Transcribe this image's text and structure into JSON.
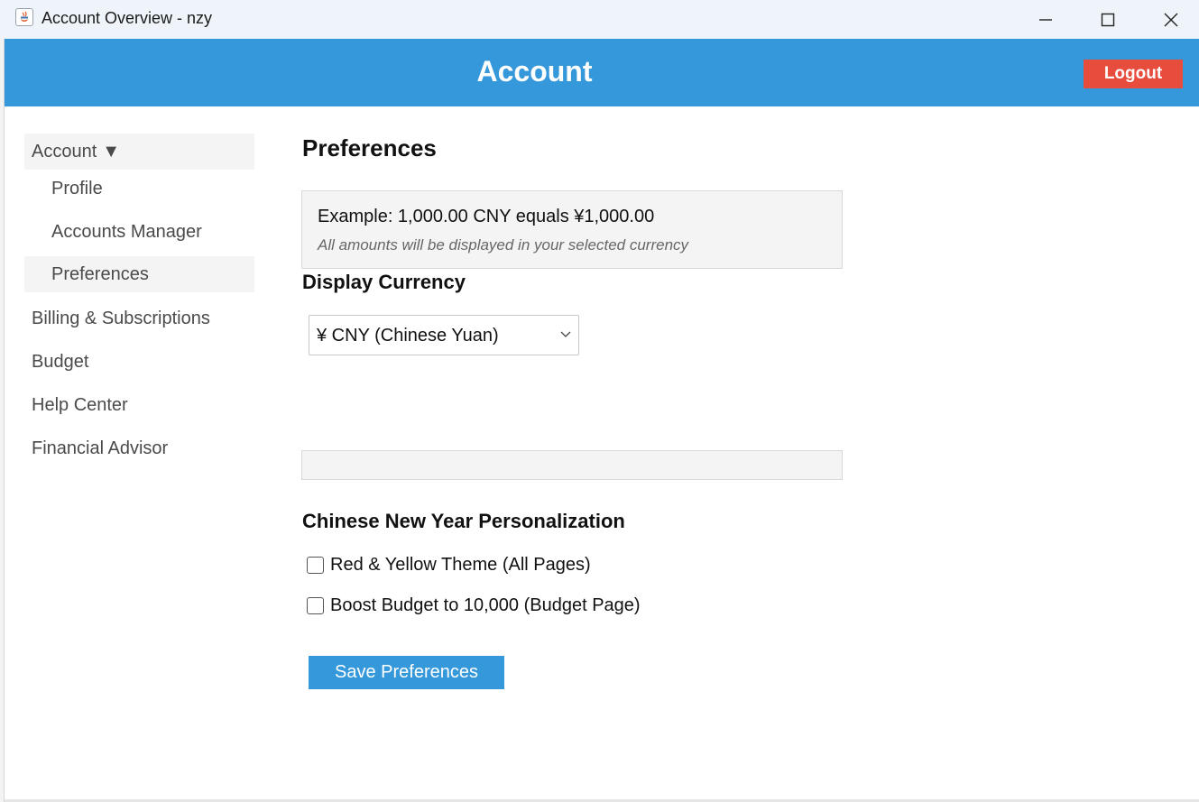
{
  "window": {
    "title": "Account Overview - nzy",
    "controls": [
      "minimize-icon",
      "maximize-icon",
      "close-icon"
    ]
  },
  "header": {
    "title": "Account",
    "logout_label": "Logout"
  },
  "sidebar": {
    "items": [
      {
        "label": "Account",
        "caret": "▼"
      },
      {
        "label": "Profile"
      },
      {
        "label": "Accounts Manager"
      },
      {
        "label": "Preferences"
      },
      {
        "label": "Billing & Subscriptions"
      },
      {
        "label": "Budget"
      },
      {
        "label": "Help Center"
      },
      {
        "label": "Financial Advisor"
      }
    ],
    "active": "Preferences"
  },
  "main": {
    "title": "Preferences",
    "example": {
      "line": "Example: 1,000.00 CNY equals ¥1,000.00",
      "note": "All amounts will be displayed in your selected currency"
    },
    "currency": {
      "heading": "Display Currency",
      "selected": "¥ CNY (Chinese Yuan)"
    },
    "personalization": {
      "heading": "Chinese New Year Personalization",
      "options": [
        {
          "label": "Red & Yellow Theme (All Pages)",
          "checked": false
        },
        {
          "label": "Boost Budget to 10,000 (Budget Page)",
          "checked": false
        }
      ]
    },
    "save_label": "Save Preferences"
  },
  "colors": {
    "header_bg": "#3598db",
    "logout_bg": "#e74c3c",
    "save_bg": "#3598db",
    "panel_bg": "#f4f4f4"
  }
}
